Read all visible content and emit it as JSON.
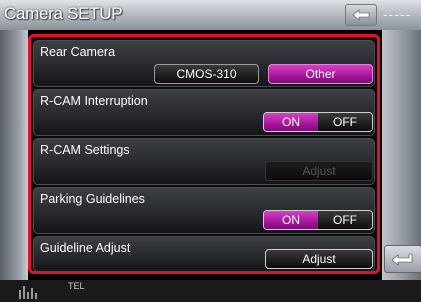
{
  "header": {
    "title": "Camera SETUP",
    "right_text": "-----"
  },
  "settings": [
    {
      "label": "Rear Camera",
      "options": [
        "CMOS-310",
        "Other"
      ],
      "selected": "Other"
    },
    {
      "label": "R-CAM Interruption",
      "on_label": "ON",
      "off_label": "OFF",
      "state": "ON"
    },
    {
      "label": "R-CAM Settings",
      "button": "Adjust",
      "enabled": false
    },
    {
      "label": "Parking Guidelines",
      "on_label": "ON",
      "off_label": "OFF",
      "state": "ON"
    },
    {
      "label": "Guideline Adjust",
      "button": "Adjust",
      "enabled": true
    }
  ],
  "footer": {
    "tel_label": "TEL"
  },
  "colors": {
    "highlight": "#e3102e",
    "active": "#b01aa3"
  }
}
